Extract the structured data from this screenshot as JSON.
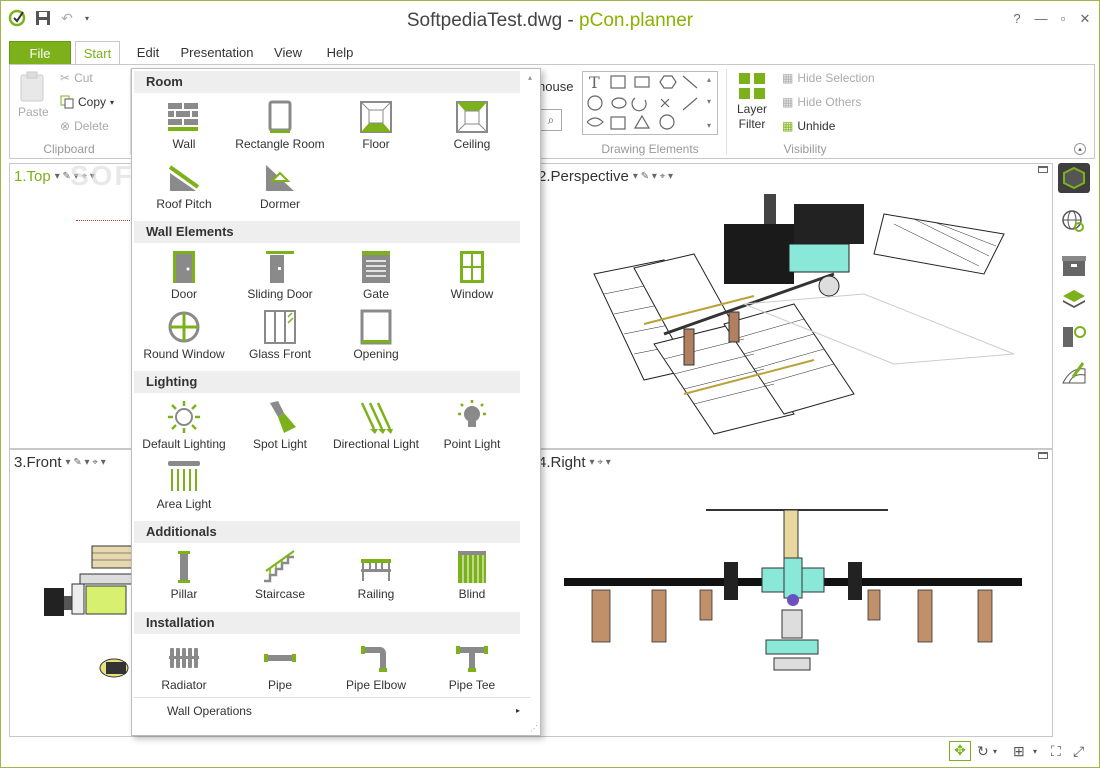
{
  "window": {
    "file": "SoftpediaTest.dwg",
    "separator": " - ",
    "app": "pCon.planner",
    "help": "?",
    "minimize": "—",
    "maximize": "▫",
    "close": "✕"
  },
  "tabs": [
    "File",
    "Start",
    "Edit",
    "Presentation",
    "View",
    "Help"
  ],
  "ribbon": {
    "clipboard": {
      "paste": "Paste",
      "cut": "Cut",
      "copy": "Copy",
      "delete": "Delete",
      "group": "Clipboard"
    },
    "partial_text": "house",
    "drawing_group": "Drawing Elements",
    "layer_filter": "Layer",
    "layer_filter2": "Filter",
    "hide_selection": "Hide Selection",
    "hide_others": "Hide Others",
    "unhide": "Unhide",
    "visibility_group": "Visibility"
  },
  "viewports": [
    {
      "label": "1.Top"
    },
    {
      "label": "2.Perspective"
    },
    {
      "label": "3.Front"
    },
    {
      "label": "4.Right"
    }
  ],
  "watermark": "SOFTPEDIA",
  "dropdown": {
    "sections": [
      {
        "title": "Room",
        "items": [
          "Wall",
          "Rectangle Room",
          "Floor",
          "Ceiling",
          "Roof Pitch",
          "Dormer"
        ]
      },
      {
        "title": "Wall Elements",
        "items": [
          "Door",
          "Sliding Door",
          "Gate",
          "Window",
          "Round Window",
          "Glass Front",
          "Opening"
        ]
      },
      {
        "title": "Lighting",
        "items": [
          "Default Lighting",
          "Spot Light",
          "Directional Light",
          "Point Light",
          "Area Light"
        ]
      },
      {
        "title": "Additionals",
        "items": [
          "Pillar",
          "Staircase",
          "Railing",
          "Blind"
        ]
      },
      {
        "title": "Installation",
        "items": [
          "Radiator",
          "Pipe",
          "Pipe Elbow",
          "Pipe Tee"
        ]
      }
    ],
    "footer": "Wall Operations"
  },
  "colors": {
    "accent": "#7cb11b",
    "accent_dark": "#5e8a10",
    "teal": "#8ae8d8",
    "gray_icon": "#8a8a8a",
    "section_bg": "#eeeeee"
  }
}
